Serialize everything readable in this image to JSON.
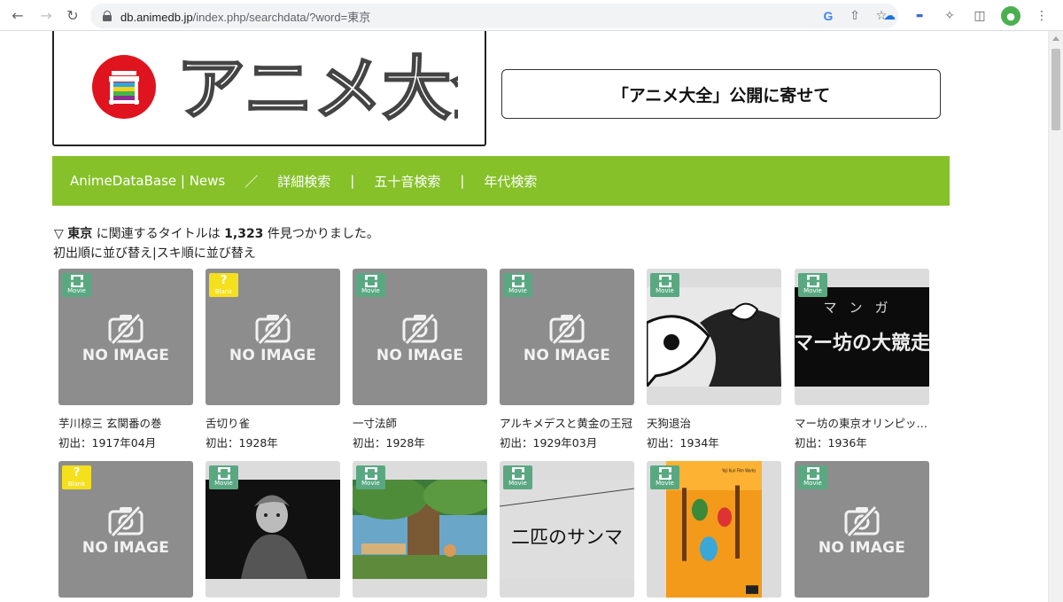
{
  "browser": {
    "url_host": "db.animedb.jp",
    "url_path": "/index.php/searchdata/?word=東京"
  },
  "header": {
    "logo_text": "アニメ大全",
    "notice_label": "「アニメ大全」公開に寄せて"
  },
  "nav": {
    "items": [
      "AnimeDataBase | News",
      "詳細検索",
      "五十音検索",
      "年代検索"
    ],
    "separators": [
      "／",
      "|",
      "|"
    ]
  },
  "search": {
    "prefix": "▽",
    "keyword": "東京",
    "mid": "に関連するタイトルは",
    "count": "1,323",
    "suffix": "件見つかりました。",
    "sort_first": "初出順に並び替え",
    "sort_sep": "|",
    "sort_like": "スキ順に並び替え"
  },
  "no_image_label": "NO IMAGE",
  "badges": {
    "movie": "Movie",
    "blank": "Blank",
    "blank_icon": "?"
  },
  "results": [
    {
      "title": "芋川椋三 玄関番の巻",
      "date": "初出：1917年04月",
      "badge": "movie",
      "image": "none"
    },
    {
      "title": "舌切り雀",
      "date": "初出：1928年",
      "badge": "blank",
      "image": "none"
    },
    {
      "title": "一寸法師",
      "date": "初出：1928年",
      "badge": "movie",
      "image": "none"
    },
    {
      "title": "アルキメデスと黄金の王冠",
      "date": "初出：1929年03月",
      "badge": "movie",
      "image": "none"
    },
    {
      "title": "天狗退治",
      "date": "初出：1934年",
      "badge": "movie",
      "image": "tengu"
    },
    {
      "title": "マー坊の東京オリンピック大競走",
      "date": "初出：1936年",
      "badge": "movie",
      "image": "maabou",
      "still_text_top": "マンガ",
      "still_text": "マー坊の大競走"
    },
    {
      "title": "",
      "date": "",
      "badge": "blank",
      "image": "none"
    },
    {
      "title": "",
      "date": "",
      "badge": "movie",
      "image": "puppet"
    },
    {
      "title": "",
      "date": "",
      "badge": "movie",
      "image": "forest"
    },
    {
      "title": "",
      "date": "",
      "badge": "movie",
      "image": "sanma",
      "still_text": "二匹のサンマ"
    },
    {
      "title": "",
      "date": "",
      "badge": "movie",
      "image": "dvd",
      "still_text": "Yoji Kuri Film Works"
    },
    {
      "title": "",
      "date": "",
      "badge": "movie",
      "image": "none"
    }
  ]
}
